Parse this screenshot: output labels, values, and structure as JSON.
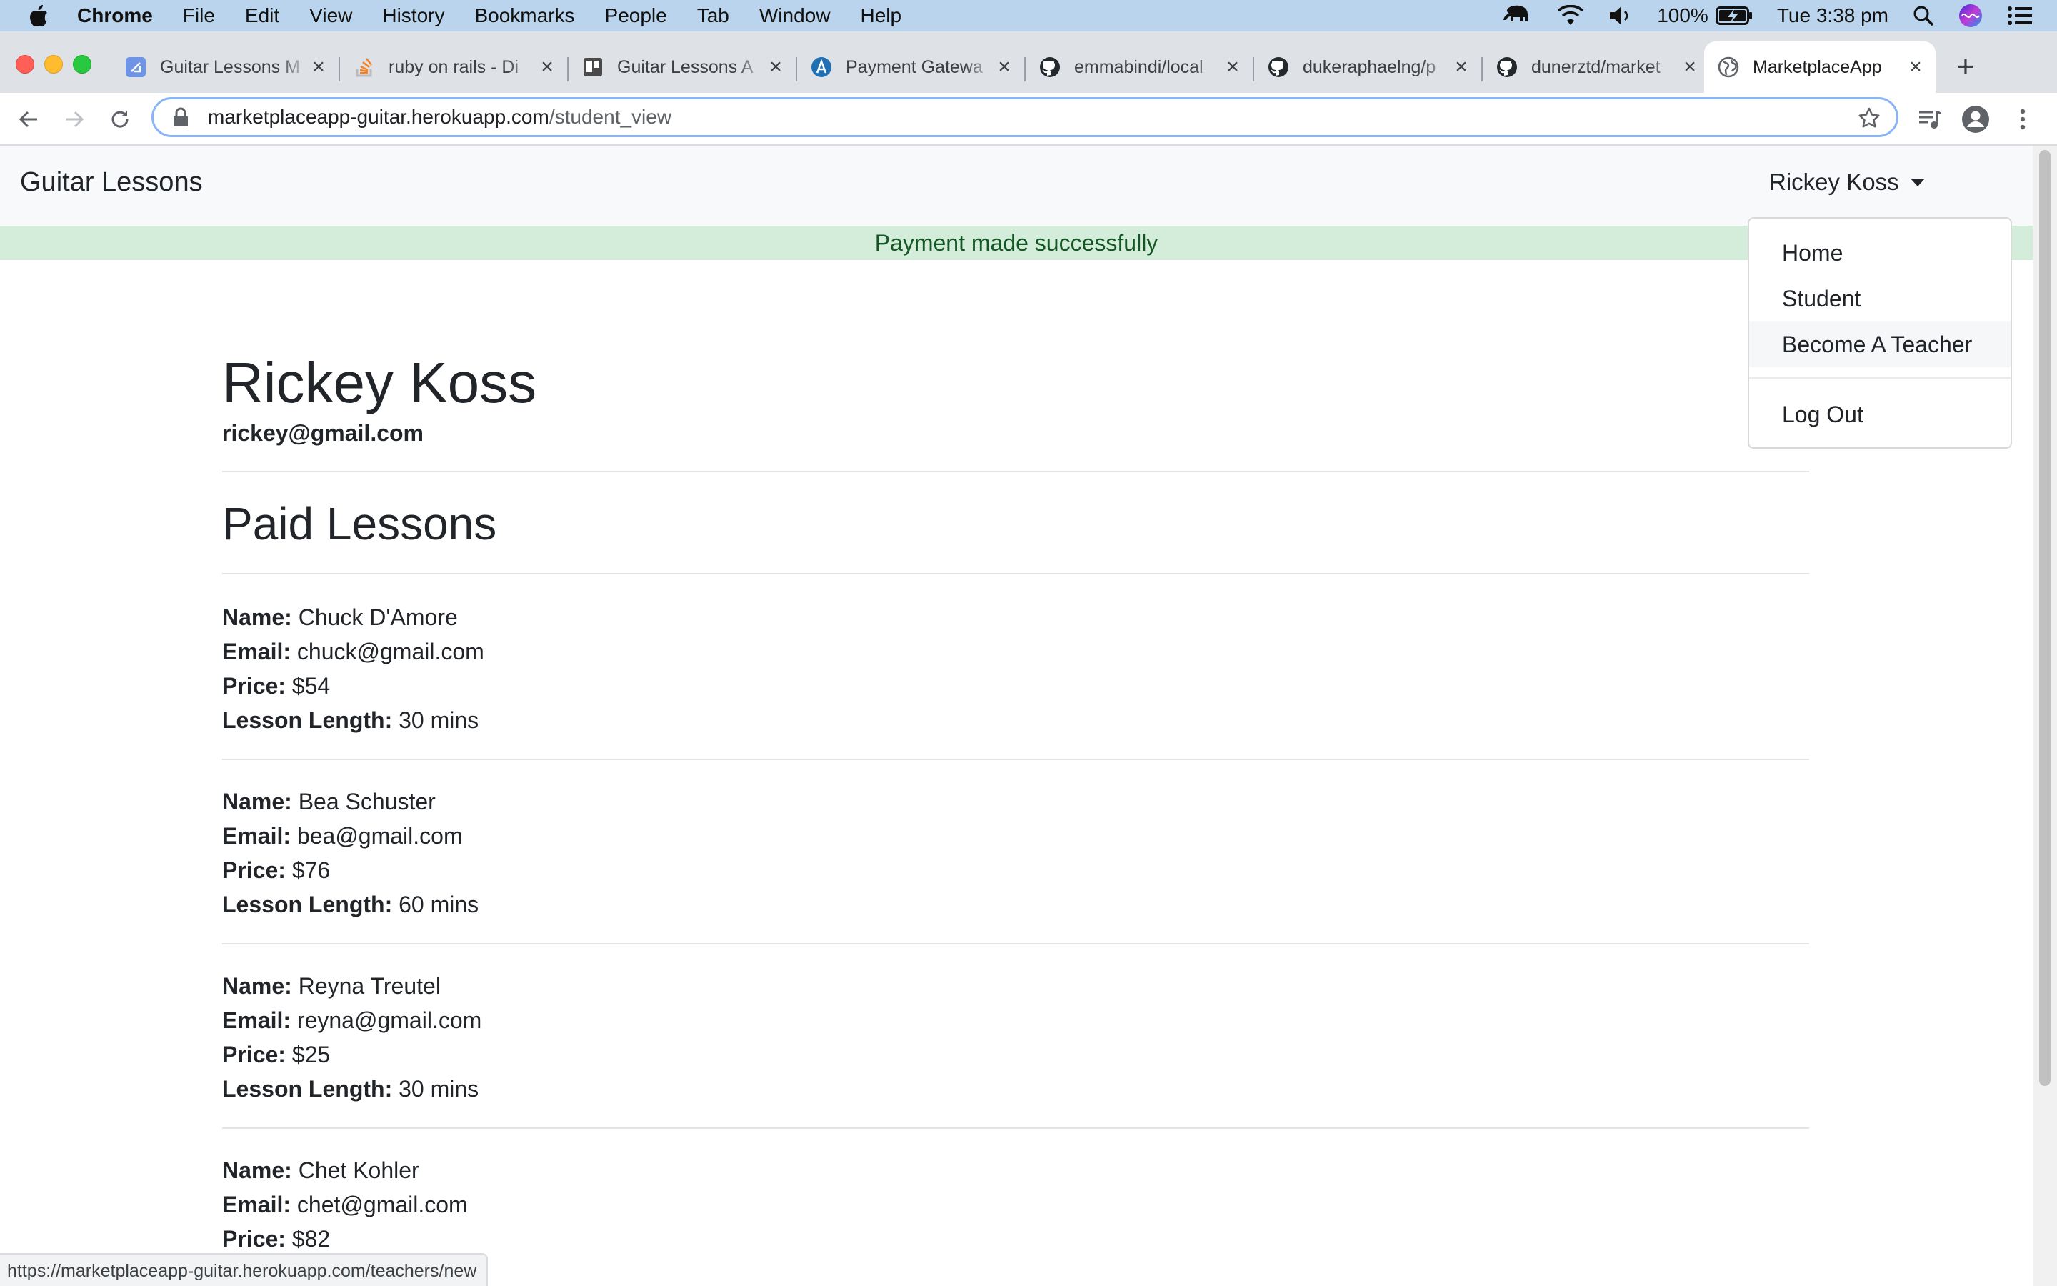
{
  "menubar": {
    "app_name": "Chrome",
    "items": [
      "File",
      "Edit",
      "View",
      "History",
      "Bookmarks",
      "People",
      "Tab",
      "Window",
      "Help"
    ],
    "battery": "100%",
    "clock": "Tue 3:38 pm"
  },
  "tabs": [
    {
      "title": "Guitar Lessons M",
      "icon": "app-icon"
    },
    {
      "title": "ruby on rails - Di",
      "icon": "stackoverflow-icon"
    },
    {
      "title": "Guitar Lessons A",
      "icon": "trello-icon"
    },
    {
      "title": "Payment Gatewa",
      "icon": "site-icon"
    },
    {
      "title": "emmabindi/local",
      "icon": "github-icon"
    },
    {
      "title": "dukeraphaelng/p",
      "icon": "github-icon"
    },
    {
      "title": "dunerztd/market",
      "icon": "github-icon"
    },
    {
      "title": "MarketplaceApp",
      "icon": "globe-icon",
      "active": true
    }
  ],
  "address_bar": {
    "host": "marketplaceapp-guitar.herokuapp.com",
    "path": "/student_view"
  },
  "navbar": {
    "brand": "Guitar Lessons",
    "user": "Rickey Koss"
  },
  "alert": {
    "message": "Payment made successfully"
  },
  "dropdown": {
    "items": [
      "Home",
      "Student",
      "Become A Teacher"
    ],
    "logout": "Log Out"
  },
  "student": {
    "name": "Rickey Koss",
    "email": "rickey@gmail.com"
  },
  "section_title": "Paid Lessons",
  "labels": {
    "name": "Name:",
    "email": "Email:",
    "price": "Price:",
    "length": "Lesson Length:"
  },
  "lessons": [
    {
      "name": "Chuck D'Amore",
      "email": "chuck@gmail.com",
      "price": "$54",
      "length": "30 mins"
    },
    {
      "name": "Bea Schuster",
      "email": "bea@gmail.com",
      "price": "$76",
      "length": "60 mins"
    },
    {
      "name": "Reyna Treutel",
      "email": "reyna@gmail.com",
      "price": "$25",
      "length": "30 mins"
    },
    {
      "name": "Chet Kohler",
      "email": "chet@gmail.com",
      "price": "$82"
    }
  ],
  "status_bar": {
    "url": "https://marketplaceapp-guitar.herokuapp.com/teachers/new"
  }
}
